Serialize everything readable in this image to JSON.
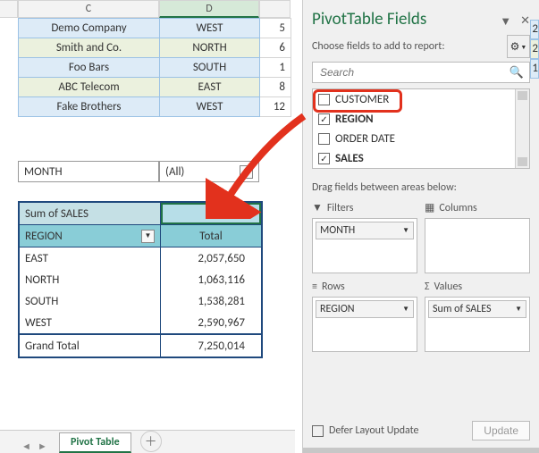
{
  "columns": {
    "c": "C",
    "d": "D"
  },
  "topTable": [
    {
      "c": "Demo Company",
      "d": "WEST",
      "e": "5"
    },
    {
      "c": "Smith and Co.",
      "d": "NORTH",
      "e": "6"
    },
    {
      "c": "Foo Bars",
      "d": "SOUTH",
      "e": "1"
    },
    {
      "c": "ABC Telecom",
      "d": "EAST",
      "e": "8"
    },
    {
      "c": "Fake Brothers",
      "d": "WEST",
      "e": "12"
    }
  ],
  "filter": {
    "field": "MONTH",
    "value": "(All)"
  },
  "pivot": {
    "sumLabel": "Sum of SALES",
    "rowLabel": "REGION",
    "colLabel": "Total",
    "rows": [
      {
        "region": "EAST",
        "total": "2,057,650"
      },
      {
        "region": "NORTH",
        "total": "1,063,116"
      },
      {
        "region": "SOUTH",
        "total": "1,538,281"
      },
      {
        "region": "WEST",
        "total": "2,590,967"
      }
    ],
    "grand": {
      "label": "Grand Total",
      "total": "7,250,014"
    }
  },
  "tab": {
    "name": "Pivot Table"
  },
  "panel": {
    "title": "PivotTable Fields",
    "subtitle": "Choose fields to add to report:",
    "searchPlaceholder": "Search",
    "fields": [
      {
        "name": "CUSTOMER",
        "checked": false,
        "bold": false
      },
      {
        "name": "REGION",
        "checked": true,
        "bold": true
      },
      {
        "name": "ORDER DATE",
        "checked": false,
        "bold": false
      },
      {
        "name": "SALES",
        "checked": true,
        "bold": true
      }
    ],
    "dragText": "Drag fields between areas below:",
    "areas": {
      "filters": {
        "label": "Filters",
        "item": "MONTH"
      },
      "columns": {
        "label": "Columns",
        "item": ""
      },
      "rows": {
        "label": "Rows",
        "item": "REGION"
      },
      "values": {
        "label": "Values",
        "item": "Sum of SALES"
      }
    },
    "defer": "Defer Layout Update",
    "update": "Update"
  },
  "rightStrip": [
    "2",
    "2",
    "1"
  ]
}
